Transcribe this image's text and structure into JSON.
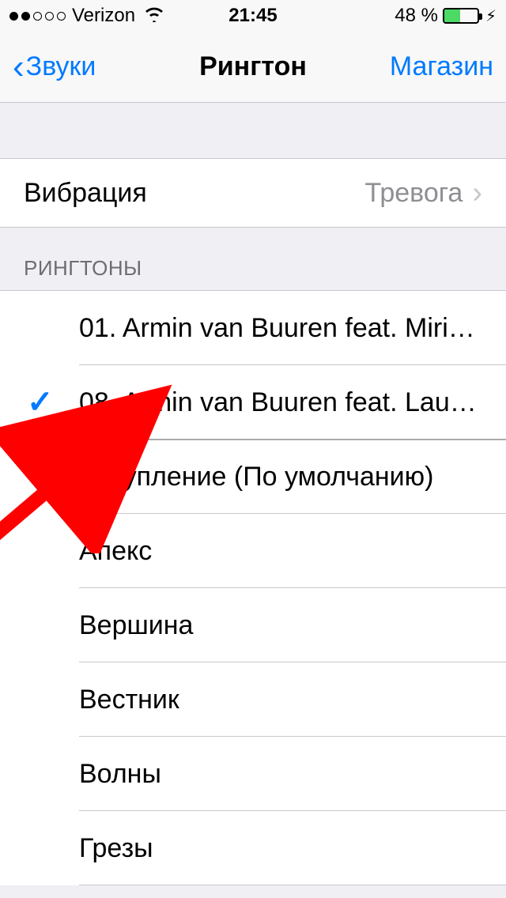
{
  "status": {
    "carrier": "Verizon",
    "time": "21:45",
    "battery_percent": "48 %",
    "battery_fill_width": "48%"
  },
  "nav": {
    "back_label": "Звуки",
    "title": "Рингтон",
    "right_label": "Магазин"
  },
  "vibration": {
    "label": "Вибрация",
    "value": "Тревога"
  },
  "ringtones": {
    "header": "РИНГТОНЫ",
    "items": [
      {
        "label": "01. Armin van Buuren feat. Miri…",
        "selected": false
      },
      {
        "label": "08. Armin van Buuren feat. Lau…",
        "selected": true
      },
      {
        "label": "Вступление (По умолчанию)",
        "selected": false
      },
      {
        "label": "Апекс",
        "selected": false
      },
      {
        "label": "Вершина",
        "selected": false
      },
      {
        "label": "Вестник",
        "selected": false
      },
      {
        "label": "Волны",
        "selected": false
      },
      {
        "label": "Грезы",
        "selected": false
      }
    ]
  }
}
